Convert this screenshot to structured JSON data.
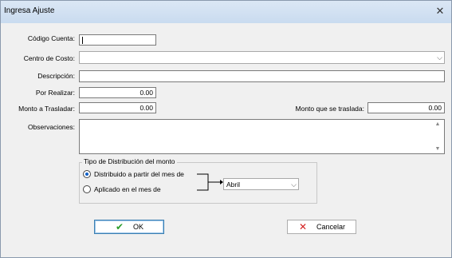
{
  "window": {
    "title": "Ingresa Ajuste"
  },
  "form": {
    "codigo_label": "Código Cuenta:",
    "codigo_value": "",
    "centro_label": "Centro de Costo:",
    "centro_value": "",
    "descripcion_label": "Descripción:",
    "descripcion_value": "",
    "por_realizar_label": "Por Realizar:",
    "por_realizar_value": "0.00",
    "monto_label": "Monto a Trasladar:",
    "monto_value": "0.00",
    "monto_traslada_label": "Monto que se traslada:",
    "monto_traslada_value": "0.00",
    "observaciones_label": "Observaciones:",
    "observaciones_value": ""
  },
  "distribucion": {
    "legend": "Tipo de Distribución del monto",
    "option1": "Distribuido a partir del mes de",
    "option2": "Aplicado en el mes de",
    "selected": "option1",
    "mes_value": "Abril"
  },
  "buttons": {
    "ok": "OK",
    "cancel": "Cancelar"
  },
  "icons": {
    "close": "close-icon",
    "ok": "check-icon",
    "cancel": "x-icon",
    "dropdown": "chevron-down-icon"
  },
  "colors": {
    "titlebar": "#dbe7f5",
    "ok_icon": "#2a9d2a",
    "cancel_icon": "#d42020",
    "radio_dot": "#1060c8"
  }
}
